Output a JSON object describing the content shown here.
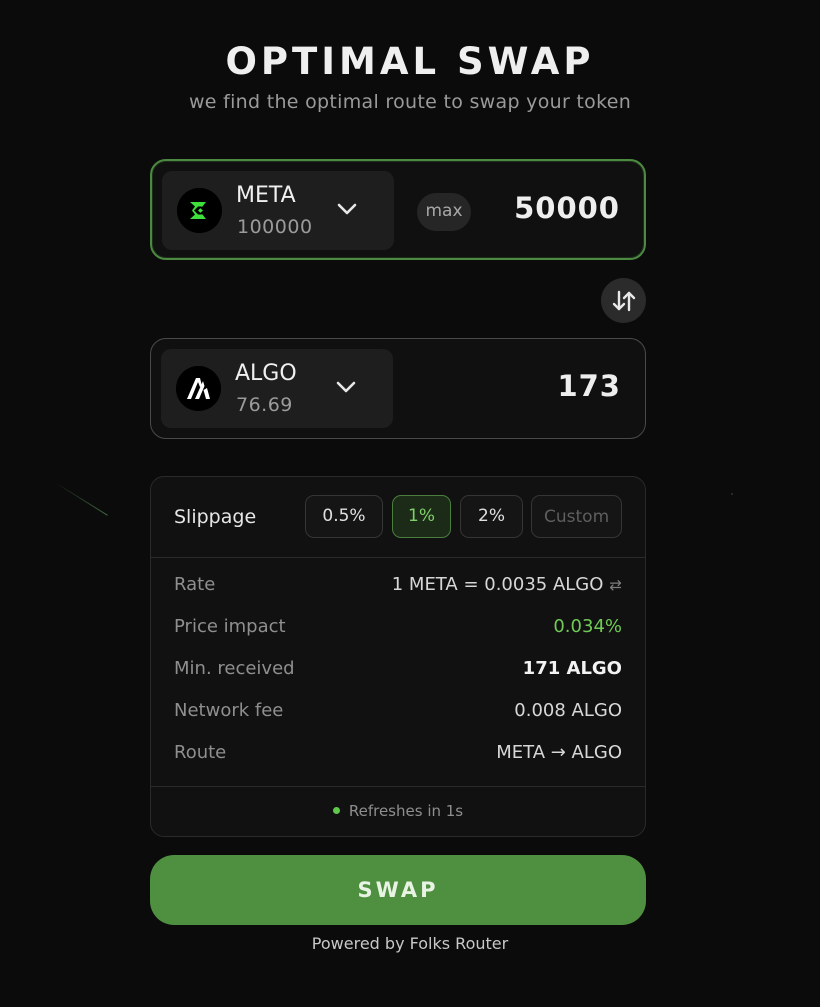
{
  "header": {
    "title": "OPTIMAL SWAP",
    "subtitle": "we find the optimal route to swap your token"
  },
  "from_token": {
    "symbol": "META",
    "balance": "100000",
    "amount": "50000",
    "max_label": "max",
    "icon": "meta-logo-icon"
  },
  "to_token": {
    "symbol": "ALGO",
    "balance": "76.69",
    "amount": "173",
    "icon": "algo-logo-icon"
  },
  "slippage": {
    "label": "Slippage",
    "options": [
      "0.5%",
      "1%",
      "2%"
    ],
    "selected": "1%",
    "custom_placeholder": "Custom"
  },
  "details": {
    "rate": {
      "label": "Rate",
      "value": "1 META = 0.0035 ALGO"
    },
    "price_impact": {
      "label": "Price impact",
      "value": "0.034%"
    },
    "min_received": {
      "label": "Min. received",
      "value": "171 ALGO"
    },
    "network_fee": {
      "label": "Network fee",
      "value": "0.008 ALGO"
    },
    "route": {
      "label": "Route",
      "value": "META → ALGO"
    }
  },
  "refresh_text": "Refreshes in 1s",
  "swap_button": "SWAP",
  "footer": "Powered by Folks Router",
  "colors": {
    "background": "#0b0b0b",
    "accent_green": "#4e8f40",
    "positive_text": "#6fcb55",
    "meta_brand": "#39e639"
  }
}
